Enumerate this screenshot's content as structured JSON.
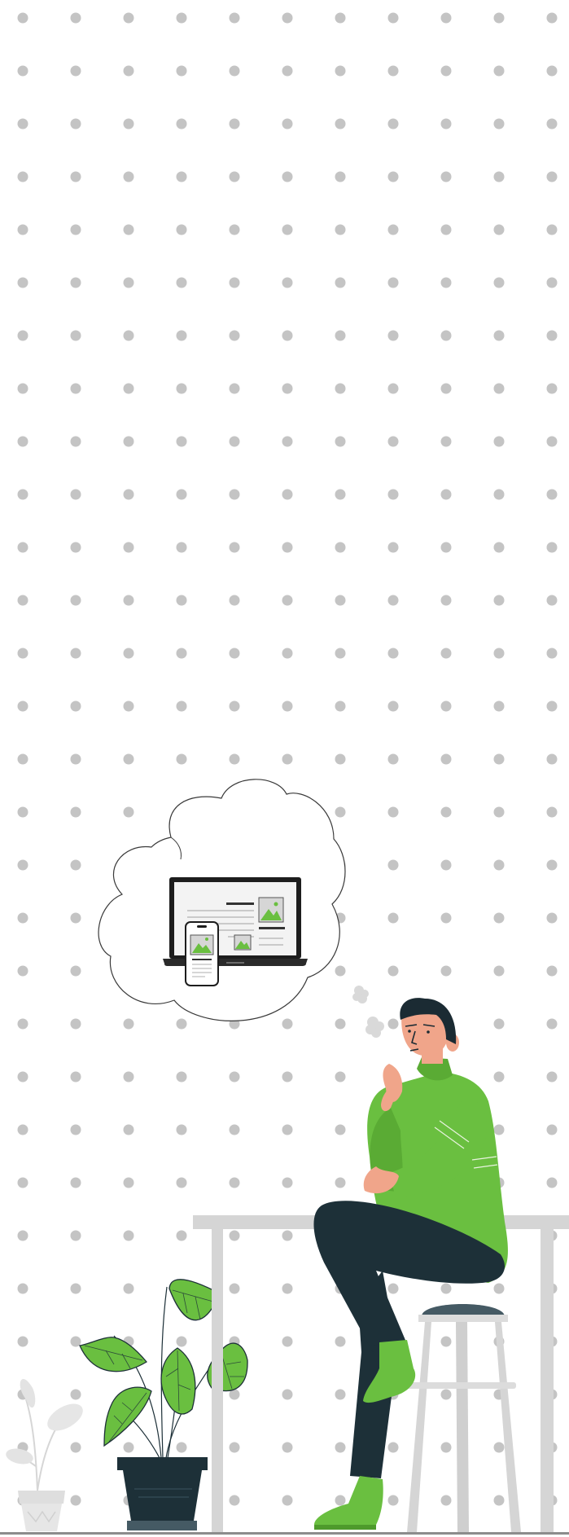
{
  "illustration": {
    "background_pattern": "dot-grid",
    "colors": {
      "background": "#ffffff",
      "dots": "#c4c4c4",
      "accent_green": "#6abf40",
      "dark_green": "#4e9a2c",
      "dark_navy": "#1d3038",
      "skin": "#f0a58a",
      "hair": "#1b2b33",
      "furniture": "#d3d3d3",
      "ghost_plant": "#e2e2e2"
    },
    "icons": [
      "thought-cloud-icon",
      "laptop-icon",
      "smartphone-icon",
      "image-placeholder-icon",
      "plant-icon",
      "stool-icon",
      "table-icon"
    ]
  }
}
